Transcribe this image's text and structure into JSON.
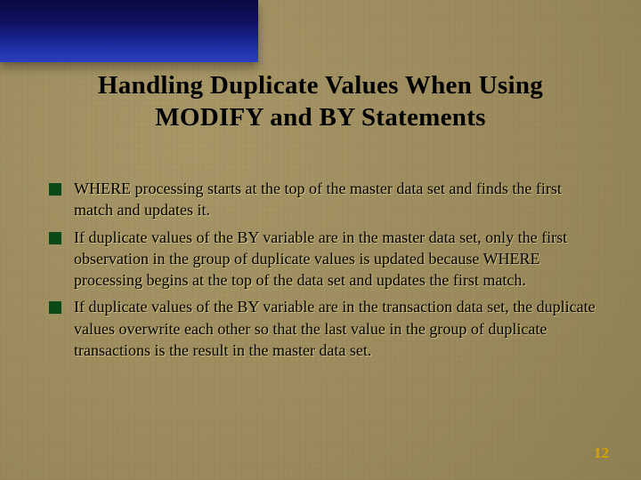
{
  "title_line1": "Handling Duplicate Values When Using",
  "title_line2": "MODIFY and BY Statements",
  "bullets": [
    "WHERE processing starts at the top of the master data set and finds the first match and updates it.",
    "If duplicate values of the BY variable are in the master data set, only the first observation in the group of duplicate values is updated because WHERE processing begins at the top of the data set and updates the first match.",
    "If duplicate values of the BY variable are in the transaction data set, the duplicate values overwrite each other so that the last value in the group of duplicate transactions is the result in the master data set."
  ],
  "page_number": "12"
}
